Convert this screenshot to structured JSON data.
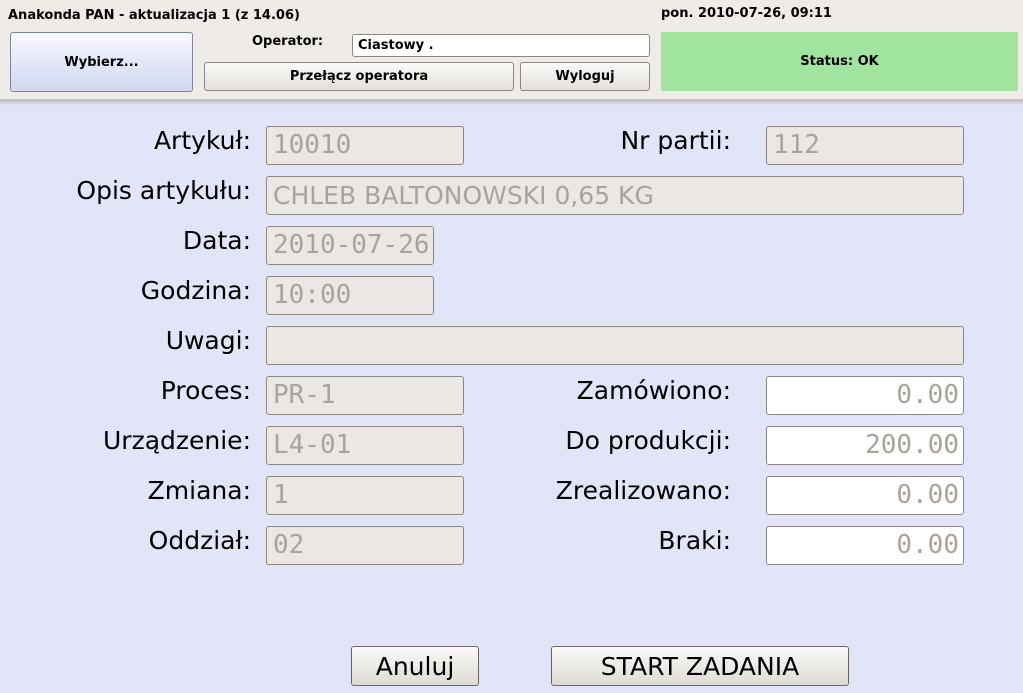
{
  "header": {
    "title": "Anakonda PAN - aktualizacja 1 (z 14.06)",
    "datetime": "pon. 2010-07-26, 09:11",
    "select_button": "Wybierz...",
    "operator_label": "Operator:",
    "operator_value": "Ciastowy .",
    "switch_operator_button": "Przełącz operatora",
    "logout_button": "Wyloguj",
    "status": "Status: OK",
    "status_color": "#a0e4a0"
  },
  "form": {
    "artykul": {
      "label": "Artykuł:",
      "value": "10010"
    },
    "nr_partii": {
      "label": "Nr partii:",
      "value": "112"
    },
    "opis": {
      "label": "Opis artykułu:",
      "value": "CHLEB BALTONOWSKI 0,65 KG"
    },
    "data": {
      "label": "Data:",
      "value": "2010-07-26"
    },
    "godzina": {
      "label": "Godzina:",
      "value": "10:00"
    },
    "uwagi": {
      "label": "Uwagi:",
      "value": ""
    },
    "proces": {
      "label": "Proces:",
      "value": "PR-1"
    },
    "urzadzenie": {
      "label": "Urządzenie:",
      "value": "L4-01"
    },
    "zmiana": {
      "label": "Zmiana:",
      "value": "1"
    },
    "oddzial": {
      "label": "Oddział:",
      "value": "02"
    },
    "zamowiono": {
      "label": "Zamówiono:",
      "value": "0.00"
    },
    "do_produkcji": {
      "label": "Do produkcji:",
      "value": "200.00"
    },
    "zrealizowano": {
      "label": "Zrealizowano:",
      "value": "0.00"
    },
    "braki": {
      "label": "Braki:",
      "value": "0.00"
    }
  },
  "footer": {
    "cancel_button": "Anuluj",
    "start_button": "START ZADANIA"
  }
}
